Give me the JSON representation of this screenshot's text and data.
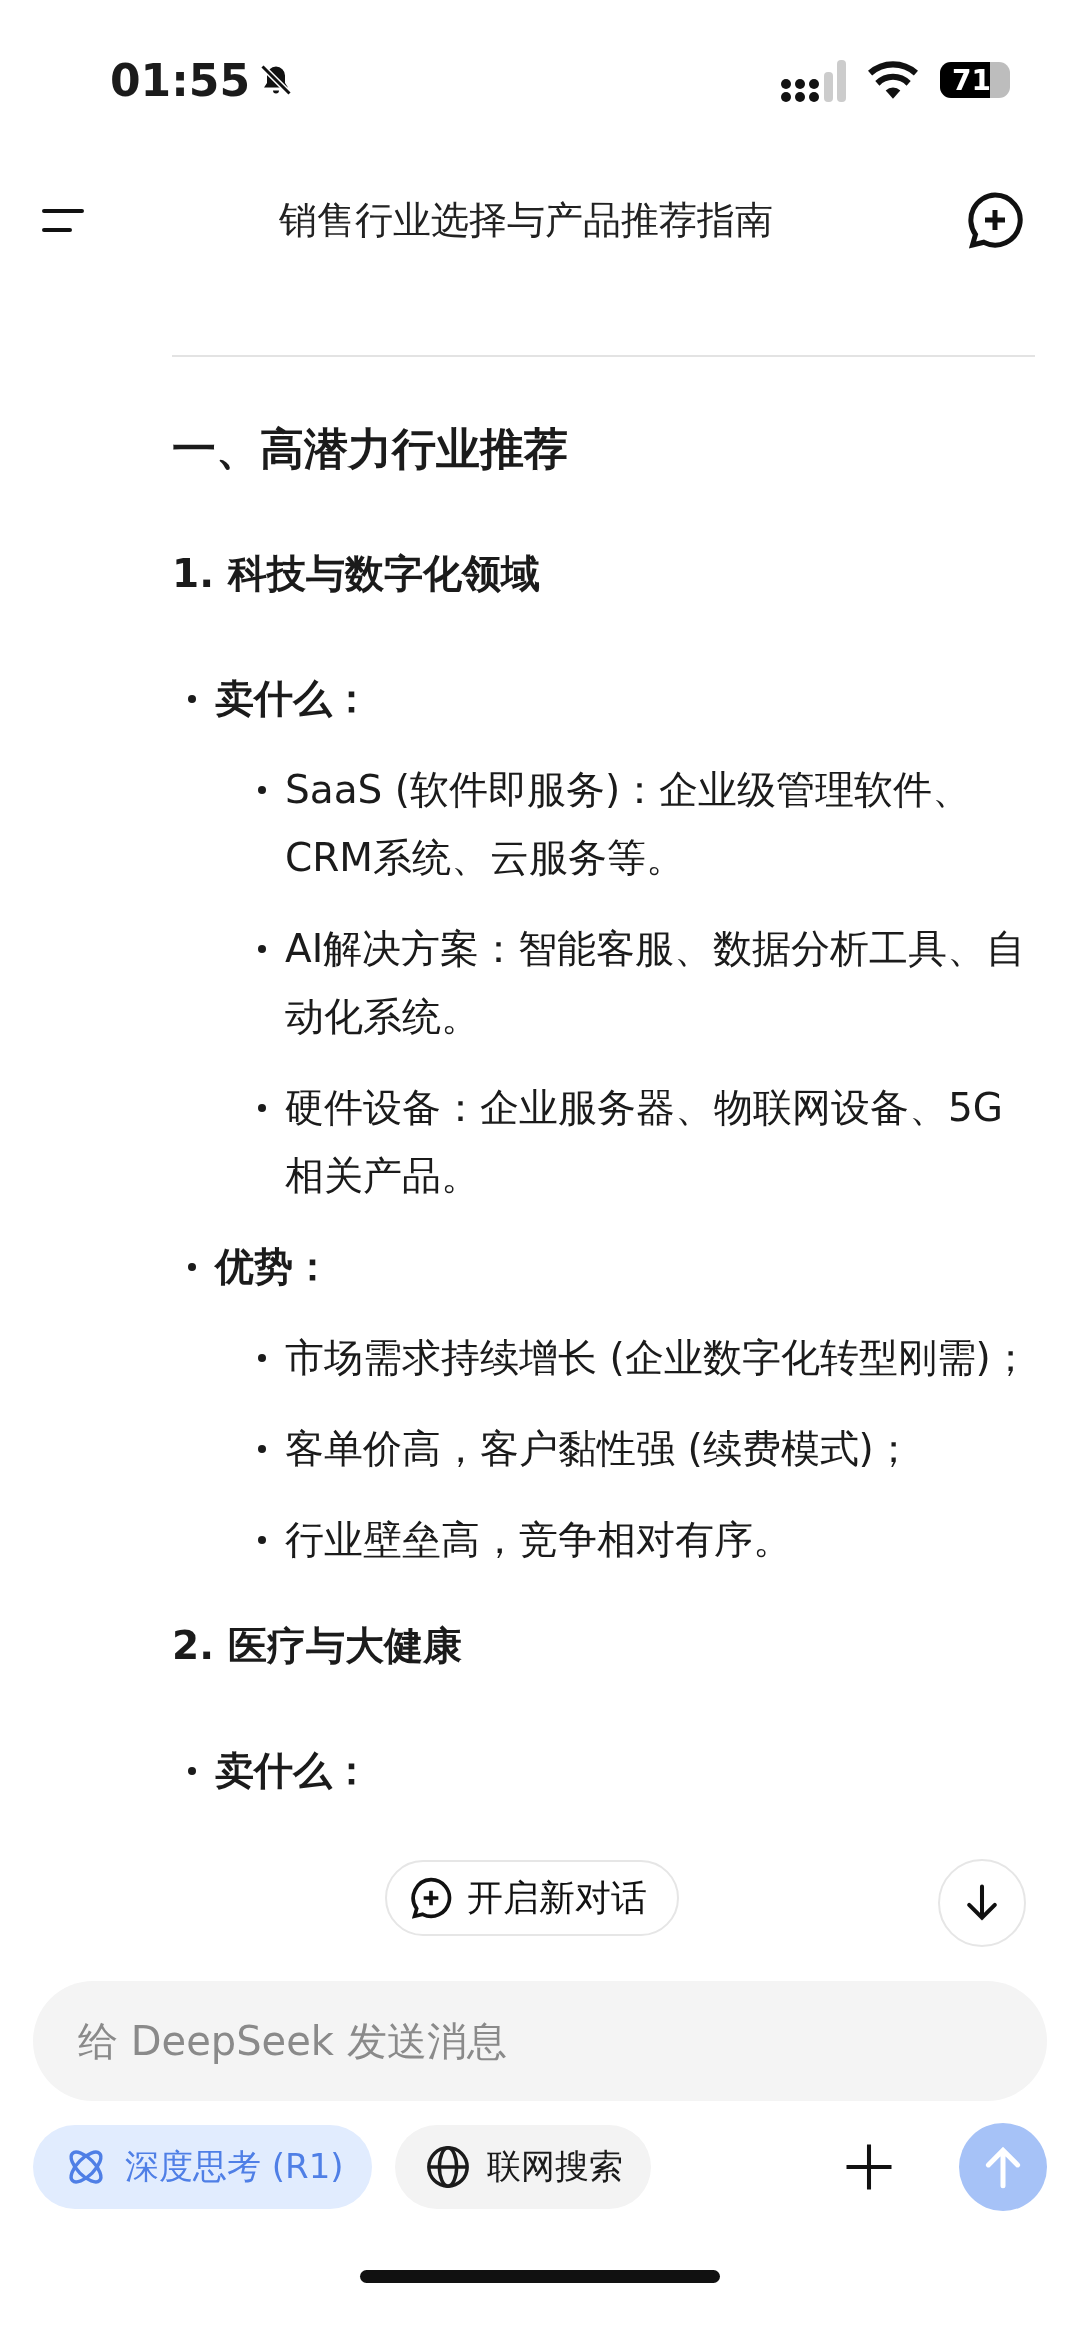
{
  "status_bar": {
    "time": "01:55",
    "silent": true,
    "battery": "71"
  },
  "header": {
    "title": "销售行业选择与产品推荐指南"
  },
  "content": [
    {
      "kind": "heading",
      "text": "一、高潜力行业推荐"
    },
    {
      "kind": "subheading",
      "text": "1. 科技与数字化领域"
    },
    {
      "kind": "bullet",
      "text": "卖什么：",
      "children": [
        {
          "text": "SaaS (软件即服务)：企业级管理软件、CRM系统、云服务等。"
        },
        {
          "text": "AI解决方案：智能客服、数据分析工具、自动化系统。"
        },
        {
          "text": "硬件设备：企业服务器、物联网设备、5G相关产品。"
        }
      ]
    },
    {
      "kind": "bullet",
      "text": "优势：",
      "children": [
        {
          "text": "市场需求持续增长 (企业数字化转型刚需)；"
        },
        {
          "text": "客单价高，客户黏性强 (续费模式)；"
        },
        {
          "text": "行业壁垒高，竞争相对有序。"
        }
      ]
    },
    {
      "kind": "subheading",
      "text": "2. 医疗与大健康"
    },
    {
      "kind": "bullet",
      "text": "卖什么："
    }
  ],
  "floating": {
    "new_chat": "开启新对话"
  },
  "composer": {
    "placeholder": "给 DeepSeek 发送消息",
    "chips": [
      {
        "kind": "deepthink",
        "label": "深度思考 (R1)",
        "selected": true
      },
      {
        "kind": "search",
        "label": "联网搜索",
        "selected": false
      }
    ]
  }
}
